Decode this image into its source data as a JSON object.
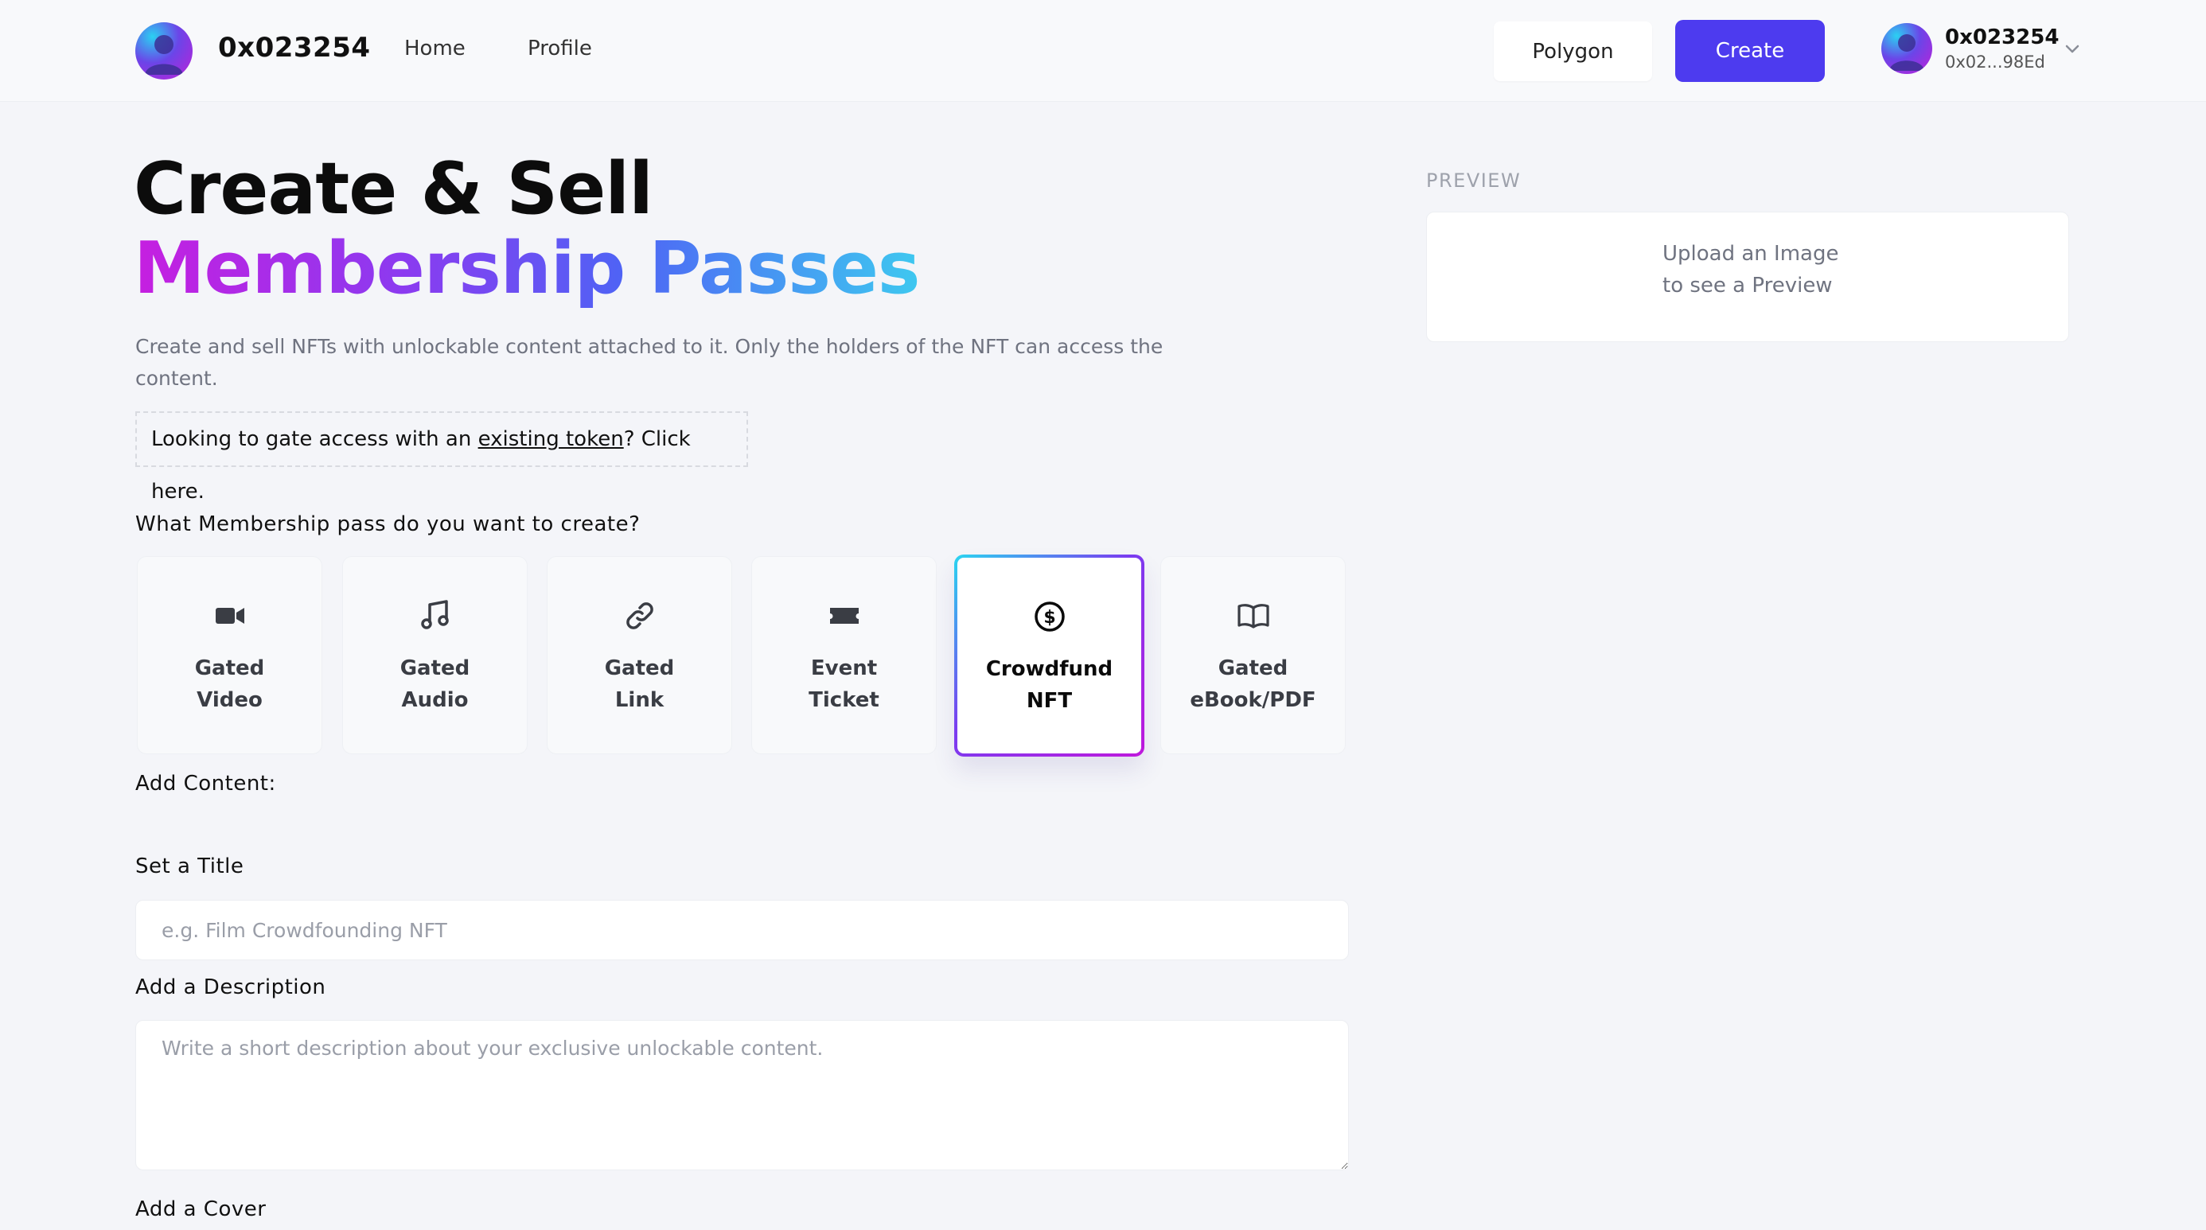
{
  "header": {
    "brand_name": "0x023254",
    "nav": {
      "home": "Home",
      "profile": "Profile"
    },
    "network_button": "Polygon",
    "create_button": "Create",
    "account": {
      "name": "0x023254",
      "address": "0x02...98Ed"
    }
  },
  "hero": {
    "title": "Create & Sell",
    "subtitle": "Membership Passes",
    "description": "Create and sell NFTs with unlockable content attached to it. Only the holders of the NFT can access the content.",
    "gate": {
      "prefix": "Looking to gate access with an ",
      "link": "existing token",
      "suffix": "? Click here."
    }
  },
  "type_question": "What Membership pass do you want to create?",
  "types": [
    {
      "line1": "Gated",
      "line2": "Video",
      "icon": "video-camera-icon",
      "selected": false
    },
    {
      "line1": "Gated",
      "line2": "Audio",
      "icon": "music-note-icon",
      "selected": false
    },
    {
      "line1": "Gated",
      "line2": "Link",
      "icon": "link-icon",
      "selected": false
    },
    {
      "line1": "Event",
      "line2": "Ticket",
      "icon": "ticket-icon",
      "selected": false
    },
    {
      "line1": "Crowdfund",
      "line2": "NFT",
      "icon": "dollar-coin-icon",
      "selected": true
    },
    {
      "line1": "Gated",
      "line2": "eBook/PDF",
      "icon": "open-book-icon",
      "selected": false
    }
  ],
  "form": {
    "add_content_label": "Add Content:",
    "title_label": "Set a Title",
    "title_placeholder": "e.g. Film Crowdfounding NFT",
    "title_value": "",
    "description_label": "Add a Description",
    "description_placeholder": "Write a short description about your exclusive unlockable content.",
    "description_value": "",
    "cover_label": "Add a Cover"
  },
  "preview": {
    "label": "PREVIEW",
    "line1": "Upload an Image",
    "line2": "to see a Preview"
  },
  "colors": {
    "accent": "#4d3bef",
    "gradient_start": "#c61fe0",
    "gradient_end": "#3ec8f0",
    "background": "#f4f5f9"
  }
}
